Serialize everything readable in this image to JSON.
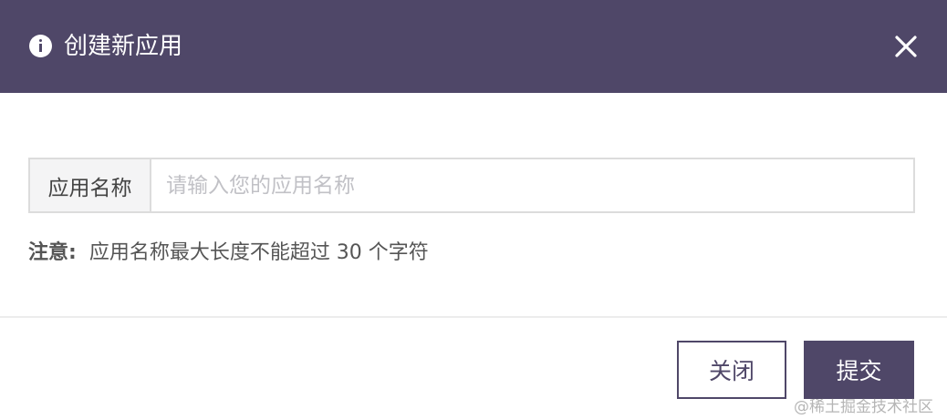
{
  "colors": {
    "header_bg": "#4f4768",
    "primary": "#4f4768",
    "placeholder": "#c1c1c6",
    "border": "#dcdcdc"
  },
  "dialog": {
    "title": "创建新应用",
    "title_icon": "info-icon",
    "close_icon": "close-icon"
  },
  "form": {
    "app_name_label": "应用名称",
    "app_name_value": "",
    "app_name_placeholder": "请输入您的应用名称"
  },
  "note": {
    "label": "注意:",
    "text": "应用名称最大长度不能超过 30 个字符"
  },
  "footer": {
    "close_label": "关闭",
    "submit_label": "提交"
  },
  "watermark": {
    "text": "@稀土掘金技术社区"
  }
}
